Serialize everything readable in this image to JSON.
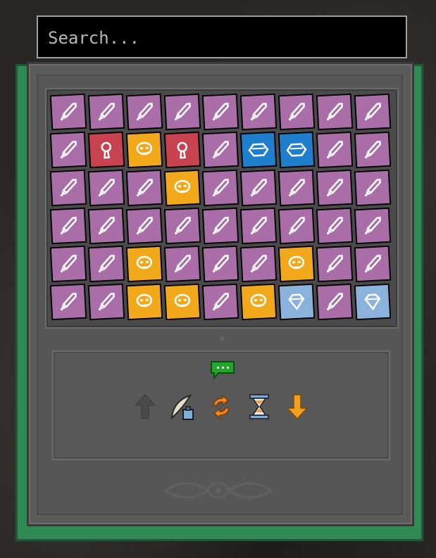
{
  "search": {
    "placeholder": "Search..."
  },
  "card_types": {
    "sword": {
      "icon": "sword-icon",
      "bg": "#a96ea8",
      "fg": "#ffffff"
    },
    "key": {
      "icon": "keyhole-icon",
      "bg": "#c8424f",
      "fg": "#ffffff"
    },
    "skull": {
      "icon": "skull-icon",
      "bg": "#f2a81b",
      "fg": "#ffffff"
    },
    "hex": {
      "icon": "hexagon-icon",
      "bg": "#1f7fcc",
      "fg": "#ffffff"
    },
    "diamond": {
      "icon": "diamond-icon",
      "bg": "#8ab2da",
      "fg": "#ffffff"
    }
  },
  "grid": [
    [
      "sword",
      "sword",
      "sword",
      "sword",
      "sword",
      "sword",
      "sword",
      "sword",
      "sword"
    ],
    [
      "sword",
      "key",
      "skull",
      "key",
      "sword",
      "hex",
      "hex",
      "sword",
      "sword"
    ],
    [
      "sword",
      "sword",
      "sword",
      "skull",
      "sword",
      "sword",
      "sword",
      "sword",
      "sword"
    ],
    [
      "sword",
      "sword",
      "sword",
      "sword",
      "sword",
      "sword",
      "sword",
      "sword",
      "sword"
    ],
    [
      "sword",
      "sword",
      "skull",
      "sword",
      "sword",
      "sword",
      "skull",
      "sword",
      "sword"
    ],
    [
      "sword",
      "sword",
      "skull",
      "skull",
      "sword",
      "skull",
      "diamond",
      "sword",
      "diamond"
    ]
  ],
  "toolbar": [
    {
      "name": "up-arrow-icon",
      "color": "#4a4a4a"
    },
    {
      "name": "quill-ink-icon",
      "color": "#d8d0c0"
    },
    {
      "name": "refresh-icon",
      "color": "#f08a20"
    },
    {
      "name": "hourglass-icon",
      "color": "#f0a040"
    },
    {
      "name": "down-arrow-icon",
      "color": "#f0a020"
    }
  ],
  "chat": {
    "name": "chat-bubble-icon",
    "color": "#1fa82a"
  }
}
